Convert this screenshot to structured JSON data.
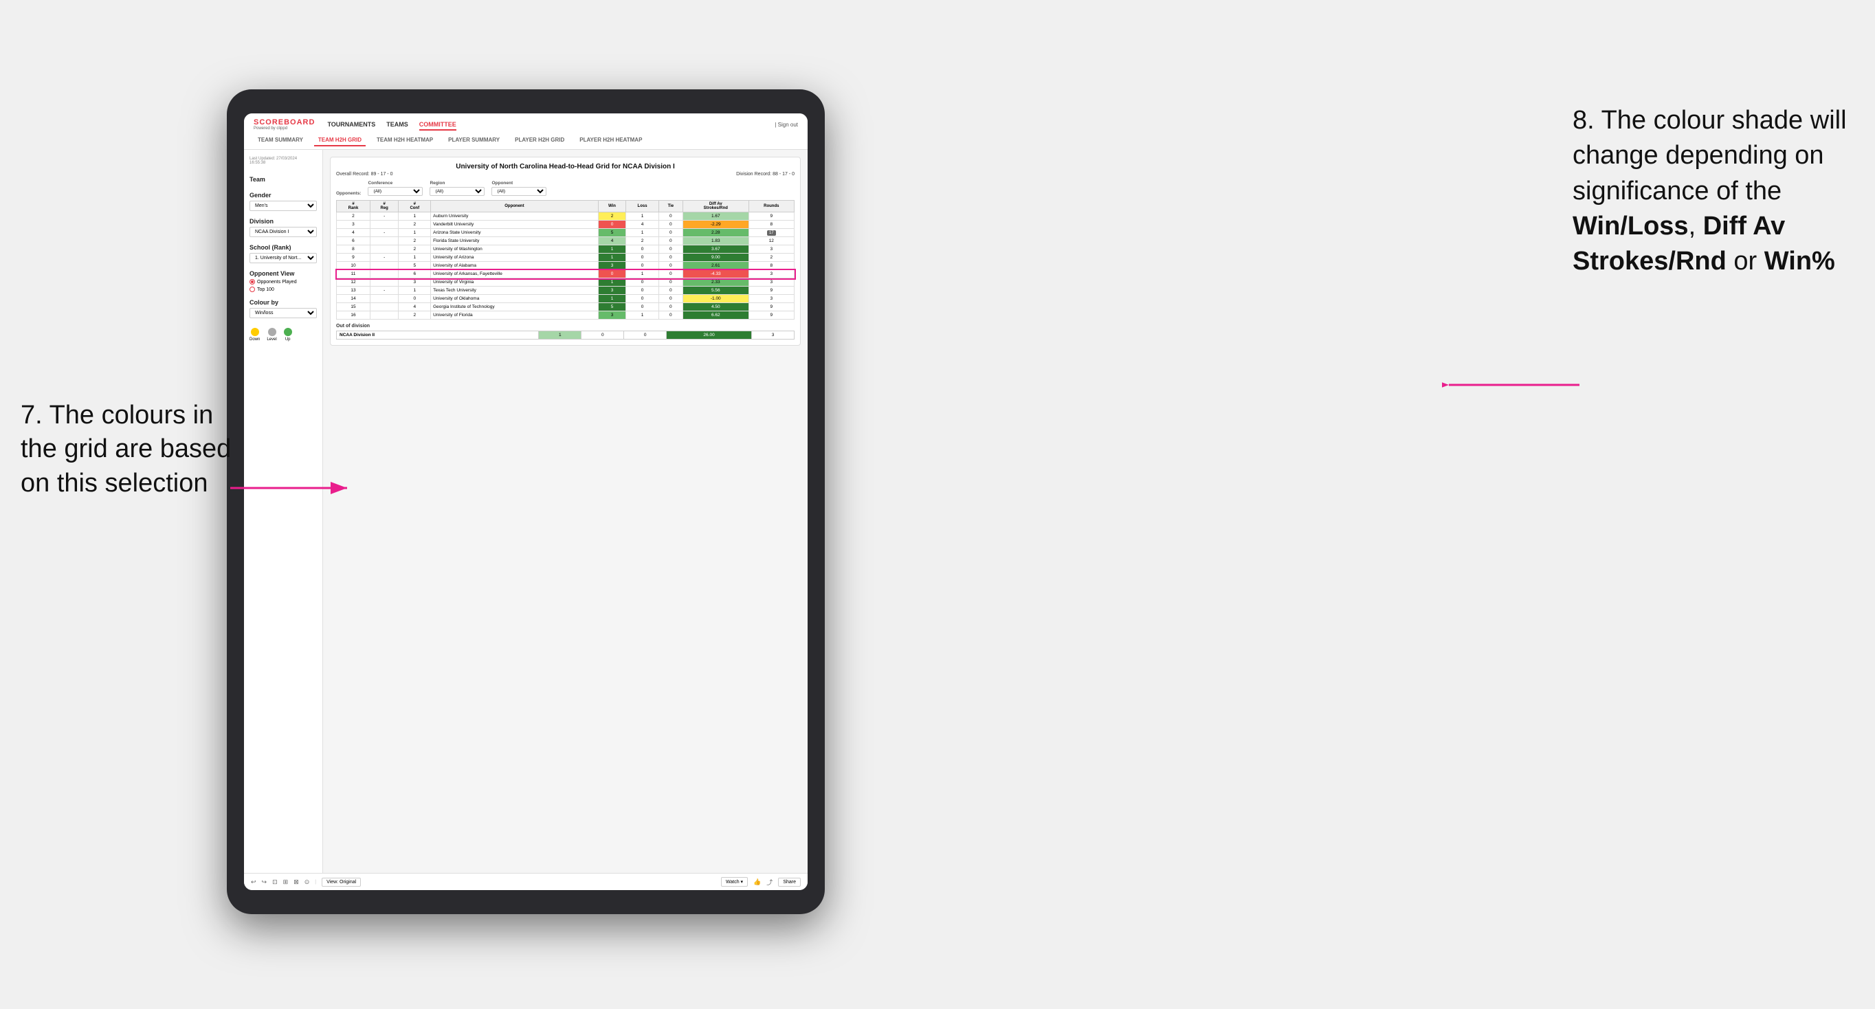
{
  "annotations": {
    "left": "7. The colours in the grid are based on this selection",
    "right_prefix": "8. The colour shade will change depending on significance of the ",
    "right_bold1": "Win/Loss",
    "right_sep1": ", ",
    "right_bold2": "Diff Av Strokes/Rnd",
    "right_sep2": " or ",
    "right_bold3": "Win%"
  },
  "nav": {
    "logo_title": "SCOREBOARD",
    "logo_sub": "Powered by clippd",
    "links": [
      "TOURNAMENTS",
      "TEAMS",
      "COMMITTEE"
    ],
    "active_link": "COMMITTEE",
    "sign_out": "| Sign out",
    "tabs": [
      "TEAM SUMMARY",
      "TEAM H2H GRID",
      "TEAM H2H HEATMAP",
      "PLAYER SUMMARY",
      "PLAYER H2H GRID",
      "PLAYER H2H HEATMAP"
    ],
    "active_tab": "TEAM H2H GRID"
  },
  "left_panel": {
    "timestamp": "Last Updated: 27/03/2024\n16:55:38",
    "team_label": "Team",
    "gender_label": "Gender",
    "gender_value": "Men's",
    "division_label": "Division",
    "division_value": "NCAA Division I",
    "school_label": "School (Rank)",
    "school_value": "1. University of Nort...",
    "opponent_view_label": "Opponent View",
    "radio_options": [
      "Opponents Played",
      "Top 100"
    ],
    "active_radio": "Opponents Played",
    "colour_by_label": "Colour by",
    "colour_by_value": "Win/loss",
    "legend": [
      {
        "label": "Down",
        "color": "#ffcc00"
      },
      {
        "label": "Level",
        "color": "#aaaaaa"
      },
      {
        "label": "Up",
        "color": "#4caf50"
      }
    ]
  },
  "grid": {
    "title": "University of North Carolina Head-to-Head Grid for NCAA Division I",
    "overall_record": "Overall Record: 89 - 17 - 0",
    "division_record": "Division Record: 88 - 17 - 0",
    "filters": {
      "conference_label": "Conference",
      "conference_value": "(All)",
      "region_label": "Region",
      "region_value": "(All)",
      "opponent_label": "Opponent",
      "opponent_value": "(All)",
      "opponents_label": "Opponents:"
    },
    "columns": [
      "#\nRank",
      "#\nReg",
      "#\nConf",
      "Opponent",
      "Win",
      "Loss",
      "Tie",
      "Diff Av\nStrokes/Rnd",
      "Rounds"
    ],
    "rows": [
      {
        "rank": "2",
        "reg": "-",
        "conf": "1",
        "opponent": "Auburn University",
        "win": "2",
        "loss": "1",
        "tie": "0",
        "diff": "1.67",
        "rounds": "9",
        "win_color": "yellow",
        "diff_color": "green_light"
      },
      {
        "rank": "3",
        "reg": "",
        "conf": "2",
        "opponent": "Vanderbilt University",
        "win": "0",
        "loss": "4",
        "tie": "0",
        "diff": "-2.29",
        "rounds": "8",
        "win_color": "red",
        "diff_color": "orange"
      },
      {
        "rank": "4",
        "reg": "-",
        "conf": "1",
        "opponent": "Arizona State University",
        "win": "5",
        "loss": "1",
        "tie": "0",
        "diff": "2.28",
        "rounds": "",
        "win_color": "green_med",
        "diff_color": "green_med",
        "rounds_badge": "17"
      },
      {
        "rank": "6",
        "reg": "",
        "conf": "2",
        "opponent": "Florida State University",
        "win": "4",
        "loss": "2",
        "tie": "0",
        "diff": "1.83",
        "rounds": "12",
        "win_color": "green_light",
        "diff_color": "green_light"
      },
      {
        "rank": "8",
        "reg": "",
        "conf": "2",
        "opponent": "University of Washington",
        "win": "1",
        "loss": "0",
        "tie": "0",
        "diff": "3.67",
        "rounds": "3",
        "win_color": "green_dark",
        "diff_color": "green_dark"
      },
      {
        "rank": "9",
        "reg": "-",
        "conf": "1",
        "opponent": "University of Arizona",
        "win": "1",
        "loss": "0",
        "tie": "0",
        "diff": "9.00",
        "rounds": "2",
        "win_color": "green_dark",
        "diff_color": "green_dark"
      },
      {
        "rank": "10",
        "reg": "",
        "conf": "5",
        "opponent": "University of Alabama",
        "win": "3",
        "loss": "0",
        "tie": "0",
        "diff": "2.61",
        "rounds": "8",
        "win_color": "green_dark",
        "diff_color": "green_med"
      },
      {
        "rank": "11",
        "reg": "",
        "conf": "6",
        "opponent": "University of Arkansas, Fayetteville",
        "win": "0",
        "loss": "1",
        "tie": "0",
        "diff": "-4.33",
        "rounds": "3",
        "win_color": "red",
        "diff_color": "red"
      },
      {
        "rank": "12",
        "reg": "",
        "conf": "3",
        "opponent": "University of Virginia",
        "win": "1",
        "loss": "0",
        "tie": "0",
        "diff": "2.33",
        "rounds": "3",
        "win_color": "green_dark",
        "diff_color": "green_med"
      },
      {
        "rank": "13",
        "reg": "-",
        "conf": "1",
        "opponent": "Texas Tech University",
        "win": "3",
        "loss": "0",
        "tie": "0",
        "diff": "5.56",
        "rounds": "9",
        "win_color": "green_dark",
        "diff_color": "green_dark"
      },
      {
        "rank": "14",
        "reg": "",
        "conf": "0",
        "opponent": "University of Oklahoma",
        "win": "1",
        "loss": "0",
        "tie": "0",
        "diff": "-1.00",
        "rounds": "3",
        "win_color": "green_dark",
        "diff_color": "yellow"
      },
      {
        "rank": "15",
        "reg": "",
        "conf": "4",
        "opponent": "Georgia Institute of Technology",
        "win": "5",
        "loss": "0",
        "tie": "0",
        "diff": "4.50",
        "rounds": "9",
        "win_color": "green_dark",
        "diff_color": "green_dark"
      },
      {
        "rank": "16",
        "reg": "",
        "conf": "2",
        "opponent": "University of Florida",
        "win": "3",
        "loss": "1",
        "tie": "0",
        "diff": "6.62",
        "rounds": "9",
        "win_color": "green_med",
        "diff_color": "green_dark"
      }
    ],
    "out_of_division_label": "Out of division",
    "out_of_division_rows": [
      {
        "name": "NCAA Division II",
        "win": "1",
        "loss": "0",
        "tie": "0",
        "diff": "26.00",
        "rounds": "3",
        "diff_color": "green_dark"
      }
    ]
  },
  "toolbar": {
    "icons": [
      "↩",
      "↪",
      "⊡",
      "⊞",
      "⊠",
      "⊙"
    ],
    "view_label": "View: Original",
    "watch_label": "Watch ▾",
    "share_label": "Share"
  }
}
